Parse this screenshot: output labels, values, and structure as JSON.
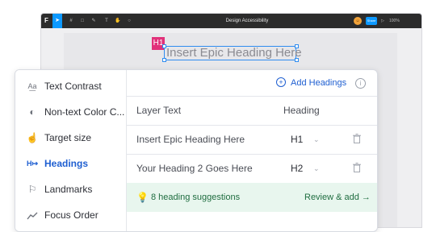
{
  "editor": {
    "file_title": "Design Accessibility",
    "share_label": "Share",
    "zoom_label": "100%"
  },
  "canvas": {
    "heading_tag": "H1",
    "heading_text": "Insert Epic Heading Here"
  },
  "sidebar": {
    "items": [
      {
        "label": "Text Contrast",
        "icon": "text-contrast-icon",
        "glyph": "Aa"
      },
      {
        "label": "Non-text Color C...",
        "icon": "half-circle-icon",
        "glyph": "◐"
      },
      {
        "label": "Target size",
        "icon": "hand-pointer-icon",
        "glyph": "☝"
      },
      {
        "label": "Headings",
        "icon": "heading-arrow-icon",
        "glyph": "H→",
        "active": true
      },
      {
        "label": "Landmarks",
        "icon": "flag-icon",
        "glyph": "⚐"
      },
      {
        "label": "Focus Order",
        "icon": "focus-order-icon",
        "glyph": "⟋"
      }
    ]
  },
  "main": {
    "add_label": "Add Headings",
    "columns": {
      "layer": "Layer Text",
      "heading": "Heading"
    },
    "rows": [
      {
        "layer": "Insert Epic Heading Here",
        "level": "H1"
      },
      {
        "layer": "Your Heading 2 Goes Here",
        "level": "H2"
      }
    ],
    "suggestion": {
      "text": "8 heading suggestions",
      "action": "Review & add →"
    }
  },
  "colors": {
    "accent": "#1f5fd1",
    "tag": "#e1317a",
    "suggestion_bg": "#e8f6ee"
  }
}
